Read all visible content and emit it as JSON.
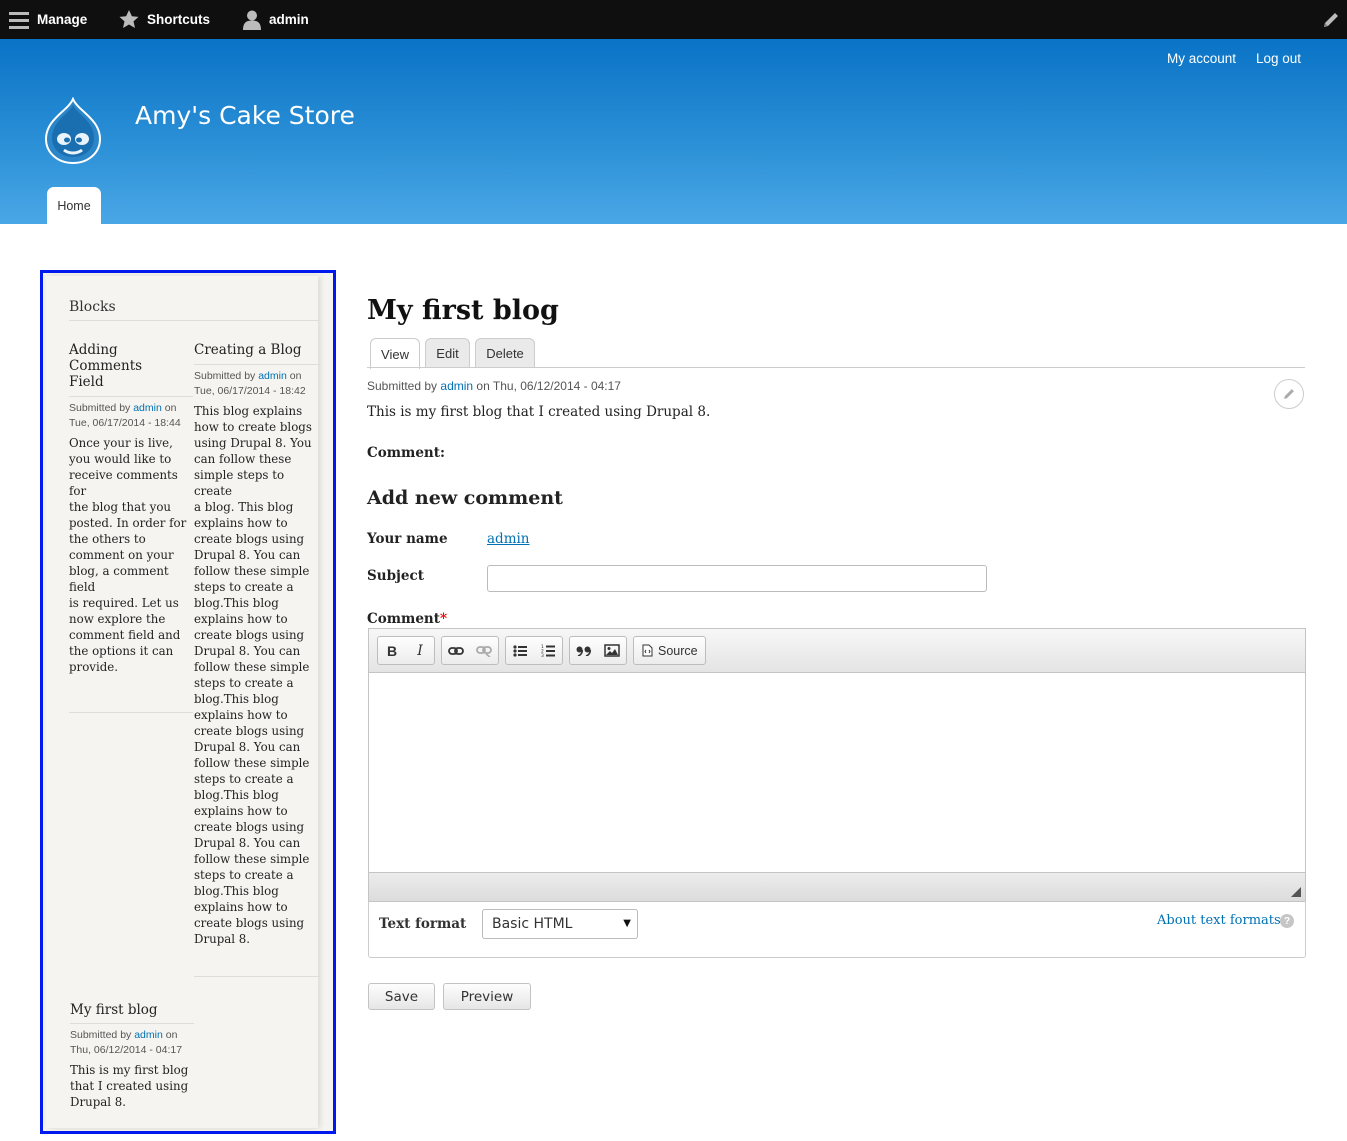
{
  "toolbar": {
    "manage_label": "Manage",
    "shortcuts_label": "Shortcuts",
    "user_label": "admin"
  },
  "header": {
    "site_name": "Amy's Cake Store",
    "secondary_menu": [
      "My account",
      "Log out"
    ],
    "main_menu": [
      "Home"
    ]
  },
  "sidebar": {
    "title": "Blocks",
    "posts": [
      {
        "title_lines": [
          "Adding Comments",
          "Field"
        ],
        "submitted_prefix": "Submitted by",
        "author": "admin",
        "submitted_on": "on",
        "date": "Tue, 06/17/2014 - 18:44",
        "body_lines": [
          "Once your is live,",
          "you would like to",
          "receive comments for",
          "the blog that you",
          "posted. In order for",
          "the others to",
          "comment on your",
          "blog, a comment field",
          "is required. Let us",
          "now explore the",
          "comment field and",
          "the options it can",
          "provide."
        ]
      },
      {
        "title_lines": [
          "Creating a Blog"
        ],
        "submitted_prefix": "Submitted by",
        "author": "admin",
        "submitted_on": "on",
        "date": "Tue, 06/17/2014 - 18:42",
        "body_lines": [
          "This blog explains",
          "how to create blogs",
          "using Drupal 8. You",
          "can follow these",
          "simple steps to create",
          "a blog. This blog",
          "explains how to",
          "create blogs using",
          "Drupal 8. You can",
          "follow these simple",
          "steps to create a",
          "blog.This blog",
          "explains how to",
          "create blogs using",
          "Drupal 8. You can",
          "follow these simple",
          "steps to create a",
          "blog.This blog",
          "explains how to",
          "create blogs using",
          "Drupal 8. You can",
          "follow these simple",
          "steps to create a",
          "blog.This blog",
          "explains how to",
          "create blogs using",
          "Drupal 8. You can",
          "follow these simple",
          "steps to create a",
          "blog.This blog",
          "explains how to",
          "create blogs using",
          "Drupal 8."
        ]
      },
      {
        "title_lines": [
          "My first blog"
        ],
        "submitted_prefix": "Submitted by",
        "author": "admin",
        "submitted_on": "on",
        "date": "Thu, 06/12/2014 - 04:17",
        "body_lines": [
          "This is my first blog",
          "that I created using",
          "Drupal 8."
        ]
      }
    ]
  },
  "node": {
    "title": "My first blog",
    "tabs": [
      "View",
      "Edit",
      "Delete"
    ],
    "submitted_prefix": "Submitted by",
    "author": "admin",
    "submitted_suffix": "on Thu, 06/12/2014 - 04:17",
    "body": "This is my first blog that I created using Drupal 8.",
    "comment_label": "Comment:"
  },
  "comment_form": {
    "heading": "Add new comment",
    "name_label": "Your name",
    "name_value": "admin",
    "subject_label": "Subject",
    "subject_value": "",
    "comment_label": "Comment",
    "required_mark": "*",
    "editor_buttons": {
      "bold": "B",
      "italic": "I",
      "source": "Source"
    },
    "text_format_label": "Text format",
    "text_format_value": "Basic HTML",
    "about_formats": "About text formats",
    "help_mark": "?",
    "save_label": "Save",
    "preview_label": "Preview"
  },
  "colors": {
    "header_top": "#0a73c6",
    "header_bottom": "#4aa7e6",
    "link": "#0071b3",
    "highlight_border": "#0019ef"
  }
}
